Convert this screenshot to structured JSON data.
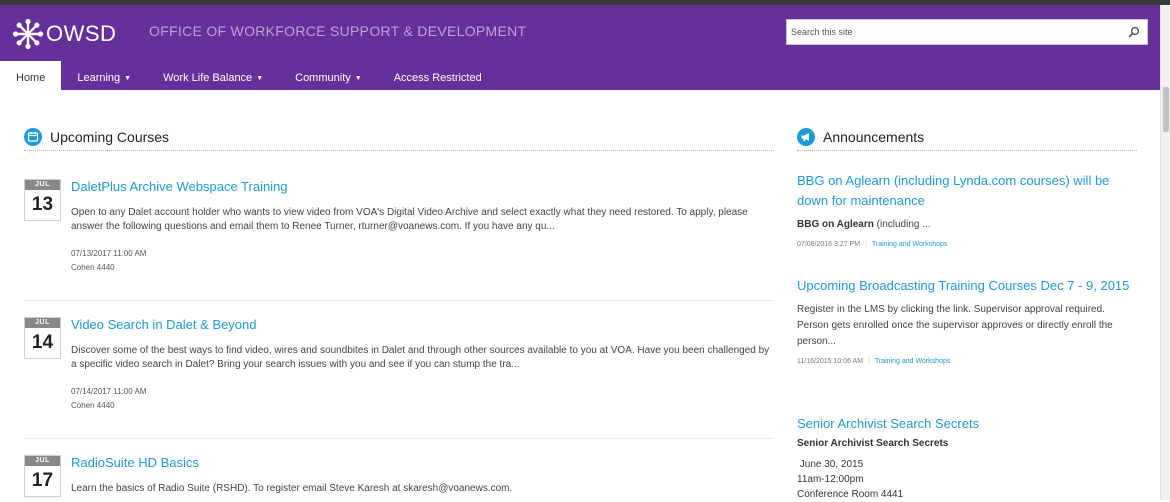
{
  "header": {
    "logo_text": "OWSD",
    "site_title": "OFFICE OF WORKFORCE SUPPORT & DEVELOPMENT",
    "search_placeholder": "Search this site"
  },
  "nav": {
    "items": [
      {
        "label": "Home",
        "caret": ""
      },
      {
        "label": "Learning",
        "caret": "▼"
      },
      {
        "label": "Work Life Balance",
        "caret": "▼"
      },
      {
        "label": "Community",
        "caret": "▼"
      },
      {
        "label": "Access Restricted",
        "caret": ""
      }
    ]
  },
  "upcoming": {
    "heading": "Upcoming Courses",
    "courses": [
      {
        "month": "JUL",
        "day": "13",
        "title": "DaletPlus Archive Webspace Training",
        "description": "Open to any Dalet account holder who wants to view video from VOA's Digital Video Archive and select exactly what they need restored. To apply, please answer the following questions and email them to Renee Turner, rturner@voanews.com. If you have any qu...",
        "datetime": "07/13/2017 11:00 AM",
        "location": "Cohen 4440"
      },
      {
        "month": "JUL",
        "day": "14",
        "title": "Video Search in Dalet & Beyond",
        "description": "Discover some of the best ways to find video, wires and soundbites in Dalet and through other sources available to you at VOA. Have you been challenged by a specific video search in Dalet? Bring your search issues with you and see if you can stump the tra...",
        "datetime": "07/14/2017 11:00 AM",
        "location": "Cohen 4440"
      },
      {
        "month": "JUL",
        "day": "17",
        "title": "RadioSuite HD Basics",
        "description": "Learn the basics of Radio Suite (RSHD). To register email Steve Karesh at skaresh@voanews.com.",
        "datetime": "",
        "location": ""
      }
    ]
  },
  "announcements": {
    "heading": "Announcements",
    "items": [
      {
        "title": "BBG on Aglearn (including Lynda.com courses) will be down for maintenance",
        "body_bold": "BBG on Aglearn",
        "body_rest": " (including ...",
        "date": "07/08/2016 3:27 PM",
        "category": "Training and Workshops"
      },
      {
        "title": "Upcoming Broadcasting Training Courses Dec 7 - 9, 2015",
        "body": "Register in the LMS by clicking the link.  Supervisor approval required. Person gets enrolled once the supervisor approves or directly enroll the person...",
        "date": "11/16/2015 10:06 AM",
        "category": "Training and Workshops"
      },
      {
        "title": "Senior Archivist Search Secrets",
        "subtitle": "Senior Archivist Search Secrets",
        "line1": " June 30, 2015",
        "line2": "11am-12:00pm",
        "line3": "Conference Room 4441"
      }
    ]
  },
  "colors": {
    "brand_purple": "#66309a",
    "link_blue": "#1e9ad6",
    "calendar_header": "#888888"
  }
}
